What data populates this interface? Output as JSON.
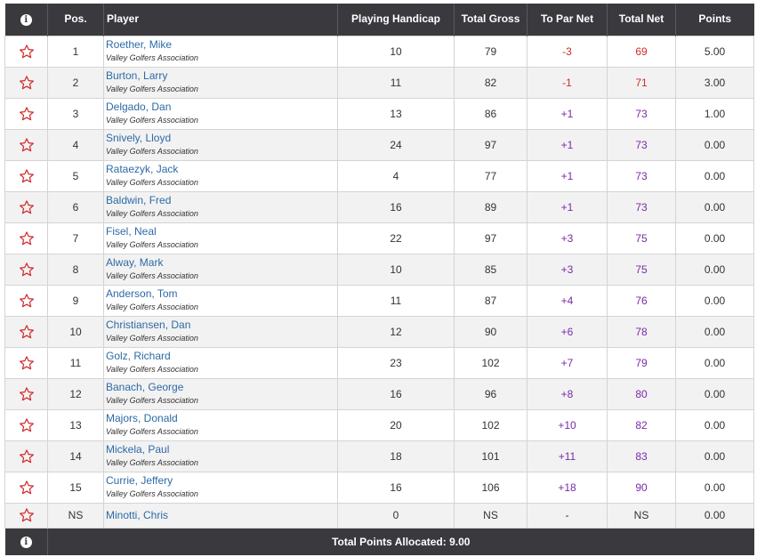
{
  "header": {
    "info_icon": "info-icon",
    "pos": "Pos.",
    "player": "Player",
    "handicap": "Playing Handicap",
    "gross": "Total Gross",
    "topar": "To Par Net",
    "net": "Total Net",
    "points": "Points"
  },
  "colors": {
    "negative": "#d12a2a",
    "positive": "#7a2aa8",
    "star": "#d12a2a",
    "header_bg": "#3a3a3e",
    "link": "#2d6aa6"
  },
  "rows": [
    {
      "pos": "1",
      "name": "Roether, Mike",
      "assoc": "Valley Golfers Association",
      "hcp": "10",
      "gross": "79",
      "topar": "-3",
      "net": "69",
      "points": "5.00",
      "tone": "neg"
    },
    {
      "pos": "2",
      "name": "Burton, Larry",
      "assoc": "Valley Golfers Association",
      "hcp": "11",
      "gross": "82",
      "topar": "-1",
      "net": "71",
      "points": "3.00",
      "tone": "neg"
    },
    {
      "pos": "3",
      "name": "Delgado, Dan",
      "assoc": "Valley Golfers Association",
      "hcp": "13",
      "gross": "86",
      "topar": "+1",
      "net": "73",
      "points": "1.00",
      "tone": "pos"
    },
    {
      "pos": "4",
      "name": "Snively, Lloyd",
      "assoc": "Valley Golfers Association",
      "hcp": "24",
      "gross": "97",
      "topar": "+1",
      "net": "73",
      "points": "0.00",
      "tone": "pos"
    },
    {
      "pos": "5",
      "name": "Rataezyk, Jack",
      "assoc": "Valley Golfers Association",
      "hcp": "4",
      "gross": "77",
      "topar": "+1",
      "net": "73",
      "points": "0.00",
      "tone": "pos"
    },
    {
      "pos": "6",
      "name": "Baldwin, Fred",
      "assoc": "Valley Golfers Association",
      "hcp": "16",
      "gross": "89",
      "topar": "+1",
      "net": "73",
      "points": "0.00",
      "tone": "pos"
    },
    {
      "pos": "7",
      "name": "Fisel, Neal",
      "assoc": "Valley Golfers Association",
      "hcp": "22",
      "gross": "97",
      "topar": "+3",
      "net": "75",
      "points": "0.00",
      "tone": "pos"
    },
    {
      "pos": "8",
      "name": "Alway, Mark",
      "assoc": "Valley Golfers Association",
      "hcp": "10",
      "gross": "85",
      "topar": "+3",
      "net": "75",
      "points": "0.00",
      "tone": "pos"
    },
    {
      "pos": "9",
      "name": "Anderson, Tom",
      "assoc": "Valley Golfers Association",
      "hcp": "11",
      "gross": "87",
      "topar": "+4",
      "net": "76",
      "points": "0.00",
      "tone": "pos"
    },
    {
      "pos": "10",
      "name": "Christiansen, Dan",
      "assoc": "Valley Golfers Association",
      "hcp": "12",
      "gross": "90",
      "topar": "+6",
      "net": "78",
      "points": "0.00",
      "tone": "pos"
    },
    {
      "pos": "11",
      "name": "Golz, Richard",
      "assoc": "Valley Golfers Association",
      "hcp": "23",
      "gross": "102",
      "topar": "+7",
      "net": "79",
      "points": "0.00",
      "tone": "pos"
    },
    {
      "pos": "12",
      "name": "Banach, George",
      "assoc": "Valley Golfers Association",
      "hcp": "16",
      "gross": "96",
      "topar": "+8",
      "net": "80",
      "points": "0.00",
      "tone": "pos"
    },
    {
      "pos": "13",
      "name": "Majors, Donald",
      "assoc": "Valley Golfers Association",
      "hcp": "20",
      "gross": "102",
      "topar": "+10",
      "net": "82",
      "points": "0.00",
      "tone": "pos"
    },
    {
      "pos": "14",
      "name": "Mickela, Paul",
      "assoc": "Valley Golfers Association",
      "hcp": "18",
      "gross": "101",
      "topar": "+11",
      "net": "83",
      "points": "0.00",
      "tone": "pos"
    },
    {
      "pos": "15",
      "name": "Currie, Jeffery",
      "assoc": "Valley Golfers Association",
      "hcp": "16",
      "gross": "106",
      "topar": "+18",
      "net": "90",
      "points": "0.00",
      "tone": "pos"
    },
    {
      "pos": "NS",
      "name": "Minotti, Chris",
      "assoc": "",
      "hcp": "0",
      "gross": "NS",
      "topar": "-",
      "net": "NS",
      "points": "0.00",
      "tone": "cnt"
    }
  ],
  "footer": {
    "info_icon": "info-icon",
    "total": "Total Points Allocated: 9.00"
  }
}
